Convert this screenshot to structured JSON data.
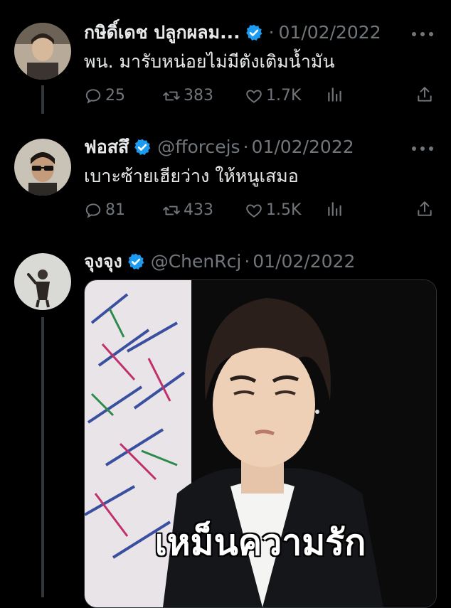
{
  "tweets": [
    {
      "display_name": "กษิดิ์เดช ปลูกผลม...",
      "handle": "",
      "separator": "·",
      "date": "01/02/2022",
      "text": "พน. มารับหน่อยไม่มีตังเติมน้ำมัน",
      "replies": "25",
      "retweets": "383",
      "likes": "1.7K"
    },
    {
      "display_name": "ฟอสสึ",
      "handle": "@fforcejs",
      "separator": "·",
      "date": "01/02/2022",
      "text": "เบาะซ้ายเฮียว่าง ให้หนูเสมอ",
      "replies": "81",
      "retweets": "433",
      "likes": "1.5K"
    },
    {
      "display_name": "จุงจุง",
      "handle": "@ChenRcj",
      "separator": "·",
      "date": "01/02/2022",
      "media_caption": "เหม็นความรัก"
    }
  ],
  "icons": {
    "verified": "verified-badge-icon",
    "more": "more-options-icon",
    "reply": "reply-icon",
    "retweet": "retweet-icon",
    "like": "like-icon",
    "views": "views-icon",
    "share": "share-icon"
  },
  "colors": {
    "background": "#000000",
    "verified": "#1d9bf0",
    "text": "#e7e9ea",
    "muted": "#71767b"
  }
}
